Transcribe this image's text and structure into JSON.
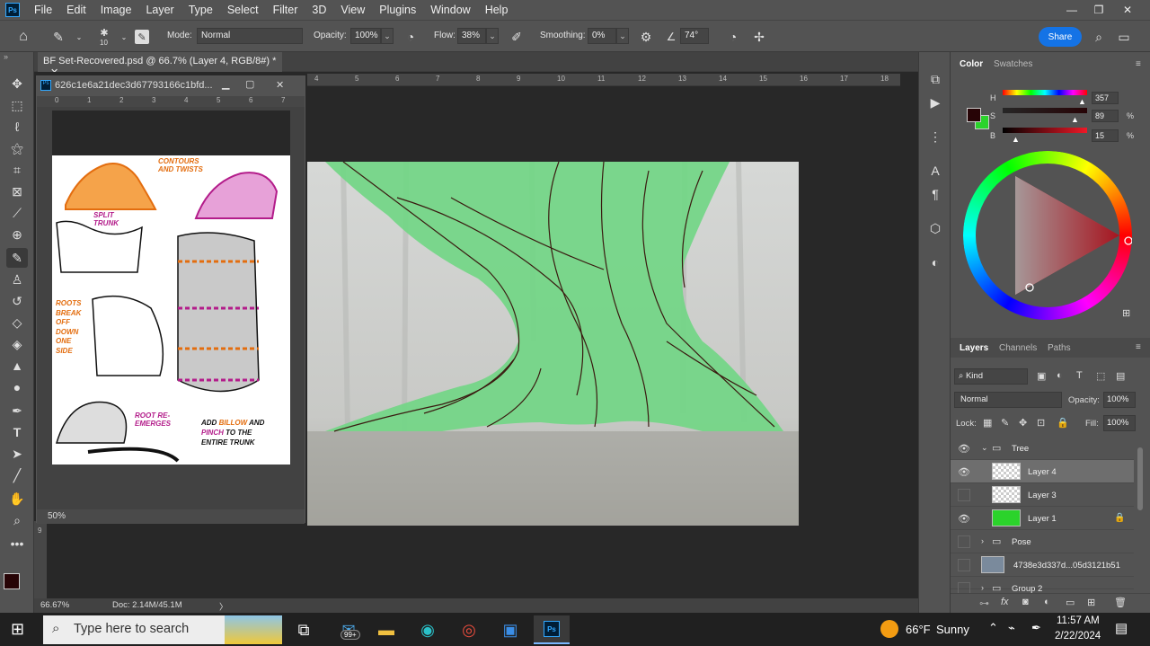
{
  "app": {
    "logo": "Ps"
  },
  "menu": [
    "File",
    "Edit",
    "Image",
    "Layer",
    "Type",
    "Select",
    "Filter",
    "3D",
    "View",
    "Plugins",
    "Window",
    "Help"
  ],
  "window_controls": {
    "minimize": "—",
    "restore": "❐",
    "close": "✕"
  },
  "options_bar": {
    "brush_size": "10",
    "mode_label": "Mode:",
    "mode_value": "Normal",
    "opacity_label": "Opacity:",
    "opacity_value": "100%",
    "flow_label": "Flow:",
    "flow_value": "38%",
    "smoothing_label": "Smoothing:",
    "smoothing_value": "0%",
    "angle_value": "74°",
    "share_label": "Share"
  },
  "document": {
    "tab_title": "BF Set-Recovered.psd @ 66.7% (Layer 4, RGB/8#) *",
    "close": "✕",
    "ruler_labels": [
      "4",
      "5",
      "6",
      "7",
      "8",
      "9",
      "10",
      "11",
      "12",
      "13",
      "14",
      "15",
      "16",
      "17",
      "18"
    ],
    "vruler_label": "9",
    "zoom": "66.67%",
    "doc_info": "Doc: 2.14M/45.1M",
    "status_arrow": "〉"
  },
  "float_window": {
    "title": "626c1e6a21dec3d67793166c1bfd...",
    "zoom": "50%",
    "ruler_labels": [
      "0",
      "1",
      "2",
      "3",
      "4",
      "5",
      "6",
      "7"
    ]
  },
  "reference_sheet": {
    "contours": "CONTOURS\nAND TWISTS",
    "split": "SPLIT\nTRUNK",
    "roots": "ROOTS\nBREAK\nOFF\nDOWN\nONE\nSIDE",
    "root_reemerges": "ROOT RE-\nEMERGES",
    "add_billow_1": "ADD",
    "add_billow_2": "BILLOW",
    "add_billow_3": "AND",
    "pinch": "PINCH",
    "pinch_rest": "TO THE",
    "entire_trunk": "ENTIRE TRUNK"
  },
  "color_panel": {
    "tabs": [
      "Color",
      "Swatches"
    ],
    "h_label": "H",
    "s_label": "S",
    "b_label": "B",
    "h_value": "357",
    "s_value": "89",
    "b_value": "15",
    "pct": "%",
    "foreground": "#270406",
    "background": "#2bd32b"
  },
  "layers_panel": {
    "tabs": [
      "Layers",
      "Channels",
      "Paths"
    ],
    "filter": "Kind",
    "blend": "Normal",
    "opacity_label": "Opacity:",
    "opacity_value": "100%",
    "lock_label": "Lock:",
    "fill_label": "Fill:",
    "fill_value": "100%",
    "layers": [
      {
        "name": "Tree",
        "type": "group",
        "visible": true,
        "expanded": true
      },
      {
        "name": "Layer 4",
        "type": "layer",
        "visible": true,
        "selected": true
      },
      {
        "name": "Layer 3",
        "type": "layer",
        "visible": false
      },
      {
        "name": "Layer 1",
        "type": "layer",
        "visible": true,
        "locked": true
      },
      {
        "name": "Pose",
        "type": "group",
        "visible": false
      },
      {
        "name": "4738e3d337d...05d3121b51",
        "type": "layer",
        "visible": false
      },
      {
        "name": "Group 2",
        "type": "group",
        "visible": false
      }
    ],
    "footer_icons": [
      "link-icon",
      "fx-icon",
      "mask-icon",
      "adjustment-icon",
      "folder-icon",
      "new-layer-icon",
      "trash-icon"
    ]
  },
  "taskbar": {
    "search_placeholder": "Type here to search",
    "badge": "99+",
    "weather_temp": "66°F",
    "weather_desc": "Sunny",
    "time": "11:57 AM",
    "date": "2/22/2024"
  }
}
